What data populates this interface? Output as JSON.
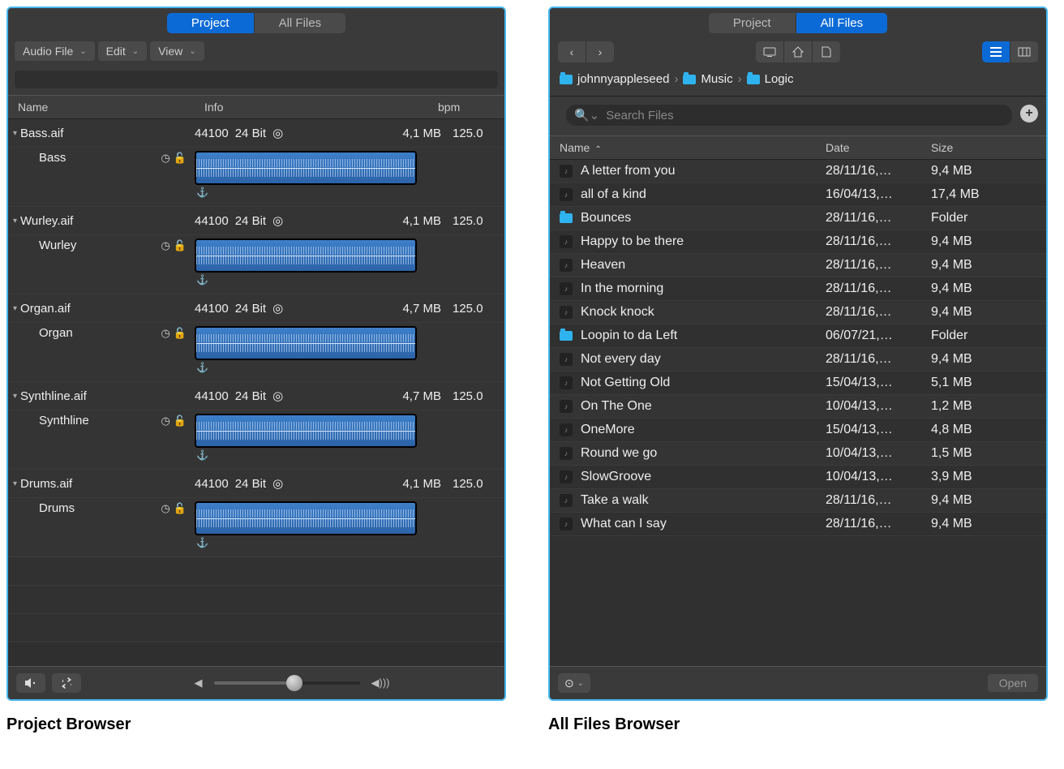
{
  "left": {
    "tabs": {
      "project": "Project",
      "allfiles": "All Files"
    },
    "dropdowns": {
      "audiofile": "Audio File",
      "edit": "Edit",
      "view": "View"
    },
    "headers": {
      "name": "Name",
      "info": "Info",
      "bpm": "bpm"
    },
    "info_suffix": {
      "rate": "44100",
      "bits": "24 Bit"
    },
    "files": [
      {
        "file": "Bass.aif",
        "region": "Bass",
        "size": "4,1 MB",
        "bpm": "125.0"
      },
      {
        "file": "Wurley.aif",
        "region": "Wurley",
        "size": "4,1 MB",
        "bpm": "125.0"
      },
      {
        "file": "Organ.aif",
        "region": "Organ",
        "size": "4,7 MB",
        "bpm": "125.0"
      },
      {
        "file": "Synthline.aif",
        "region": "Synthline",
        "size": "4,7 MB",
        "bpm": "125.0"
      },
      {
        "file": "Drums.aif",
        "region": "Drums",
        "size": "4,1 MB",
        "bpm": "125.0"
      }
    ],
    "caption": "Project Browser"
  },
  "right": {
    "tabs": {
      "project": "Project",
      "allfiles": "All Files"
    },
    "crumbs": [
      "johnnyappleseed",
      "Music",
      "Logic"
    ],
    "search_placeholder": "Search Files",
    "headers": {
      "name": "Name",
      "date": "Date",
      "size": "Size"
    },
    "rows": [
      {
        "name": "A letter from you",
        "date": "28/11/16,…",
        "size": "9,4 MB",
        "kind": "file"
      },
      {
        "name": "all of a kind",
        "date": "16/04/13,…",
        "size": "17,4 MB",
        "kind": "file"
      },
      {
        "name": "Bounces",
        "date": "28/11/16,…",
        "size": "Folder",
        "kind": "folder"
      },
      {
        "name": "Happy to be there",
        "date": "28/11/16,…",
        "size": "9,4 MB",
        "kind": "file"
      },
      {
        "name": "Heaven",
        "date": "28/11/16,…",
        "size": "9,4 MB",
        "kind": "file"
      },
      {
        "name": "In the morning",
        "date": "28/11/16,…",
        "size": "9,4 MB",
        "kind": "file"
      },
      {
        "name": "Knock knock",
        "date": "28/11/16,…",
        "size": "9,4 MB",
        "kind": "file"
      },
      {
        "name": "Loopin to da Left",
        "date": "06/07/21,…",
        "size": "Folder",
        "kind": "folder"
      },
      {
        "name": "Not every day",
        "date": "28/11/16,…",
        "size": "9,4 MB",
        "kind": "file"
      },
      {
        "name": "Not Getting Old",
        "date": "15/04/13,…",
        "size": "5,1 MB",
        "kind": "file"
      },
      {
        "name": "On The One",
        "date": "10/04/13,…",
        "size": "1,2 MB",
        "kind": "file"
      },
      {
        "name": "OneMore",
        "date": "15/04/13,…",
        "size": "4,8 MB",
        "kind": "file"
      },
      {
        "name": "Round we go",
        "date": "10/04/13,…",
        "size": "1,5 MB",
        "kind": "file"
      },
      {
        "name": "SlowGroove",
        "date": "10/04/13,…",
        "size": "3,9 MB",
        "kind": "file"
      },
      {
        "name": "Take a walk",
        "date": "28/11/16,…",
        "size": "9,4 MB",
        "kind": "file"
      },
      {
        "name": "What can I say",
        "date": "28/11/16,…",
        "size": "9,4 MB",
        "kind": "file"
      }
    ],
    "open_label": "Open",
    "caption": "All Files Browser"
  }
}
